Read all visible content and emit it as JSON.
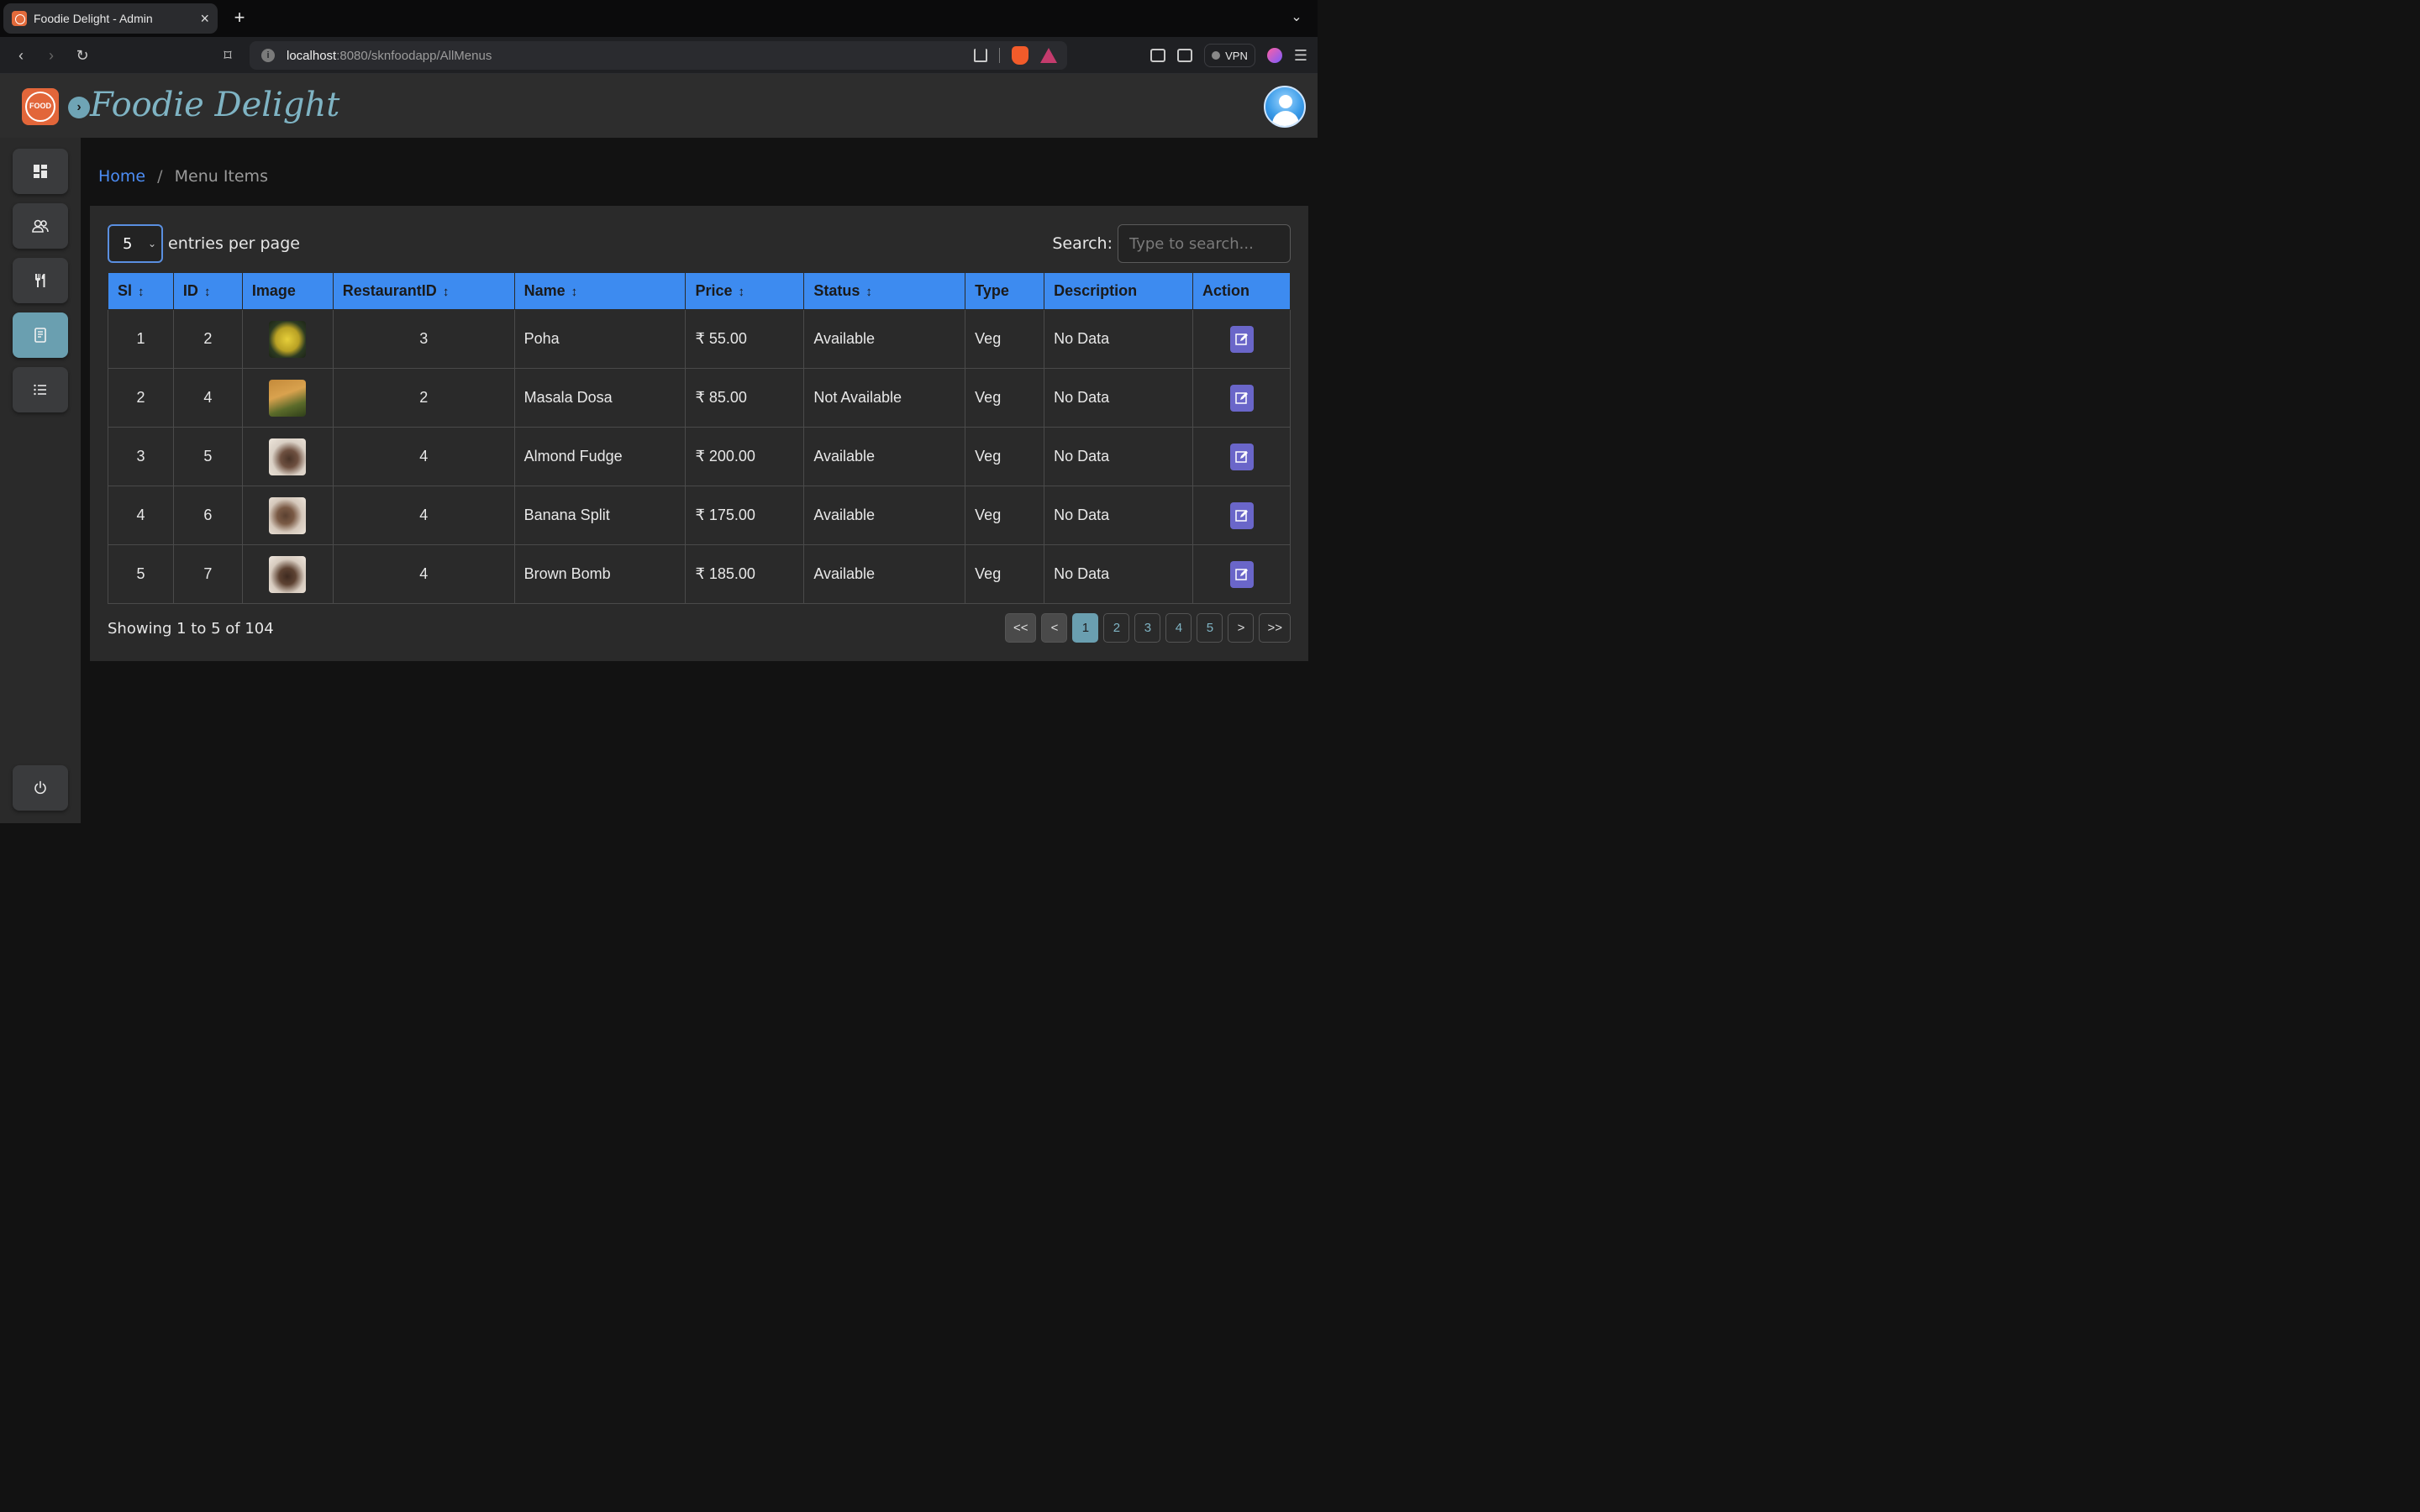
{
  "browser": {
    "tab_title": "Foodie Delight - Admin",
    "tab_close": "×",
    "new_tab": "+",
    "url_host": "localhost",
    "url_path": ":8080/sknfoodapp/AllMenus",
    "vpn_label": "VPN"
  },
  "header": {
    "logo_text": "FOOD",
    "brand": "Foodie Delight",
    "toggle_icon": "›"
  },
  "sidebar": {
    "items": [
      {
        "icon": "dashboard-icon",
        "active": false
      },
      {
        "icon": "users-icon",
        "active": false
      },
      {
        "icon": "restaurant-icon",
        "active": false
      },
      {
        "icon": "menu-book-icon",
        "active": true
      },
      {
        "icon": "list-icon",
        "active": false
      }
    ],
    "logout_icon": "power-icon"
  },
  "breadcrumb": {
    "home": "Home",
    "separator": "/",
    "current": "Menu Items"
  },
  "controls": {
    "entries_value": "5",
    "entries_label": "entries per page",
    "search_label": "Search:",
    "search_placeholder": "Type to search..."
  },
  "table": {
    "headers": [
      "Sl",
      "ID",
      "Image",
      "RestaurantID",
      "Name",
      "Price",
      "Status",
      "Type",
      "Description",
      "Action"
    ],
    "sort_glyph": "↕",
    "rows": [
      {
        "sl": "1",
        "id": "2",
        "restaurant_id": "3",
        "name": "Poha",
        "price": "₹ 55.00",
        "status": "Available",
        "type": "Veg",
        "description": "No Data"
      },
      {
        "sl": "2",
        "id": "4",
        "restaurant_id": "2",
        "name": "Masala Dosa",
        "price": "₹ 85.00",
        "status": "Not Available",
        "type": "Veg",
        "description": "No Data"
      },
      {
        "sl": "3",
        "id": "5",
        "restaurant_id": "4",
        "name": "Almond Fudge",
        "price": "₹ 200.00",
        "status": "Available",
        "type": "Veg",
        "description": "No Data"
      },
      {
        "sl": "4",
        "id": "6",
        "restaurant_id": "4",
        "name": "Banana Split",
        "price": "₹ 175.00",
        "status": "Available",
        "type": "Veg",
        "description": "No Data"
      },
      {
        "sl": "5",
        "id": "7",
        "restaurant_id": "4",
        "name": "Brown Bomb",
        "price": "₹ 185.00",
        "status": "Available",
        "type": "Veg",
        "description": "No Data"
      }
    ]
  },
  "footer": {
    "showing": "Showing 1 to 5 of 104",
    "pager": {
      "first": "<<",
      "prev": "<",
      "pages": [
        "1",
        "2",
        "3",
        "4",
        "5"
      ],
      "next": ">",
      "last": ">>",
      "current": "1"
    }
  },
  "colors": {
    "accent": "#3d8bf0",
    "sidebar_active": "#6a9fb0",
    "edit_button": "#6a66c9",
    "brand": "#7fb4c4"
  }
}
